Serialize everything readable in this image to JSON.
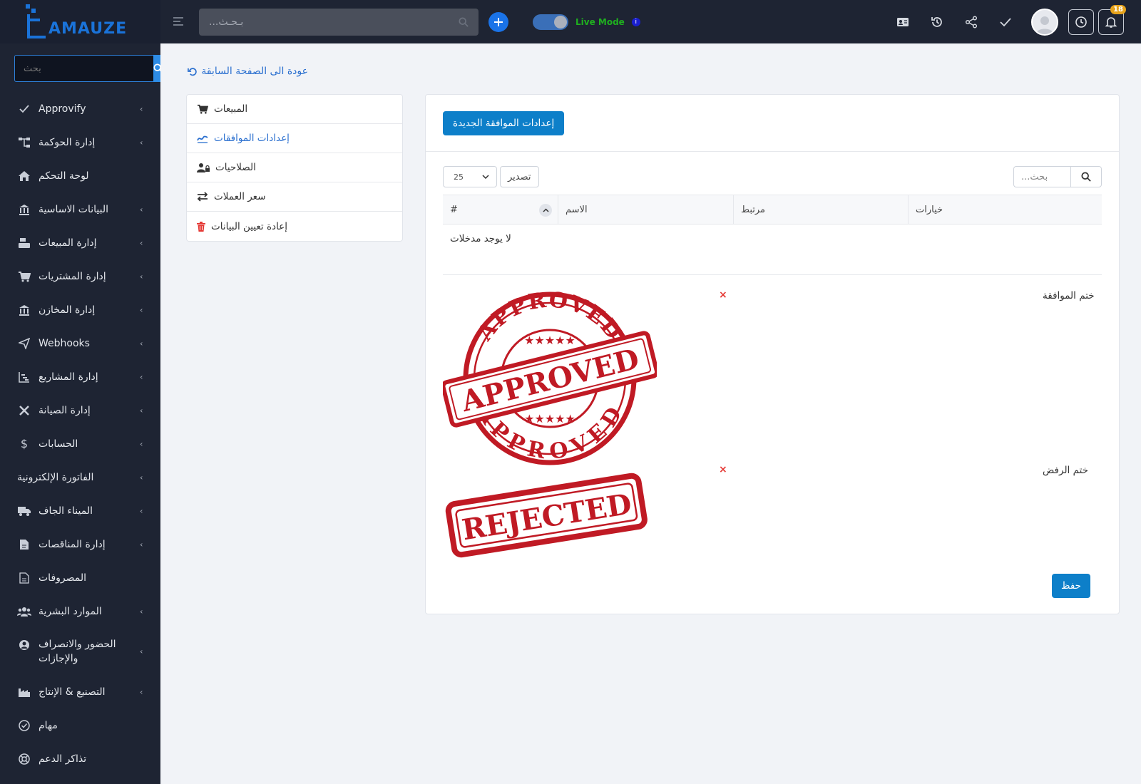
{
  "app": {
    "logo_text": "AMAUZE"
  },
  "sidebar": {
    "search_placeholder": "بحث",
    "items": [
      {
        "label": "Approvify",
        "icon": "check-icon",
        "has_children": true
      },
      {
        "label": "إدارة الحوكمة",
        "icon": "sitemap-icon",
        "has_children": true
      },
      {
        "label": "لوحة التحكم",
        "icon": "home-icon",
        "has_children": false
      },
      {
        "label": "البيانات الاساسية",
        "icon": "bank-icon",
        "has_children": true
      },
      {
        "label": "إدارة المبيعات",
        "icon": "cash-register-icon",
        "has_children": true
      },
      {
        "label": "إدارة المشتريات",
        "icon": "cart-icon",
        "has_children": true
      },
      {
        "label": "إدارة المخازن",
        "icon": "warehouse-icon",
        "has_children": true
      },
      {
        "label": "Webhooks",
        "icon": "send-icon",
        "has_children": true
      },
      {
        "label": "إدارة المشاريع",
        "icon": "gantt-icon",
        "has_children": true
      },
      {
        "label": "إدارة الصيانة",
        "icon": "tools-icon",
        "has_children": true
      },
      {
        "label": "الحسابات",
        "icon": "dollar-icon",
        "has_children": true
      },
      {
        "label": "الفاتورة الإلكترونية",
        "icon": "",
        "has_children": true
      },
      {
        "label": "الميناء الجاف",
        "icon": "truck-icon",
        "has_children": true
      },
      {
        "label": "إدارة المناقصات",
        "icon": "file-contract-icon",
        "has_children": true
      },
      {
        "label": "المصروفات",
        "icon": "document-icon",
        "has_children": false
      },
      {
        "label": "الموارد البشرية",
        "icon": "users-icon",
        "has_children": true
      },
      {
        "label": "الحضور والانصراف والإجازات",
        "icon": "user-circle-icon",
        "has_children": true
      },
      {
        "label": "التصنيع & الإنتاج",
        "icon": "industry-icon",
        "has_children": true
      },
      {
        "label": "مهام",
        "icon": "check-circle-icon",
        "has_children": false
      },
      {
        "label": "تذاكر الدعم",
        "icon": "lifebuoy-icon",
        "has_children": false
      }
    ]
  },
  "topbar": {
    "search_placeholder": "...بـحـث",
    "live_mode_label": "Live Mode",
    "notifications_count": "18"
  },
  "page": {
    "back_link": "عودة الى الصفحة السابقة",
    "settings_menu": [
      {
        "label": "المبيعات",
        "icon": "cart-icon",
        "active": false
      },
      {
        "label": "إعدادات الموافقات",
        "icon": "approval-icon",
        "active": true
      },
      {
        "label": "الصلاحيات",
        "icon": "user-lock-icon",
        "active": false
      },
      {
        "label": "سعر العملات",
        "icon": "exchange-icon",
        "active": false
      },
      {
        "label": "إعادة تعيين البيانات",
        "icon": "trash-icon",
        "active": false
      }
    ],
    "new_button": "إعدادات الموافقة الجديدة",
    "page_size": "25",
    "export_label": "تصدير",
    "table_search_placeholder": "...بحث",
    "table": {
      "columns": [
        "#",
        "الاسم",
        "مرتبط",
        "خيارات"
      ],
      "empty_text": "لا يوجد مدخلات"
    },
    "approval_stamp_label": "ختم الموافقة",
    "approval_stamp_text": "APPROVED",
    "rejection_stamp_label": "ختم الرفض",
    "rejection_stamp_text": "REJECTED",
    "remove_symbol": "×",
    "save_label": "حفظ"
  },
  "colors": {
    "sidebar_bg": "#1e2433",
    "primary": "#0d7fc9",
    "stamp_red": "#c01a24",
    "live_green": "#1fb01f",
    "badge": "#e6a21a"
  }
}
